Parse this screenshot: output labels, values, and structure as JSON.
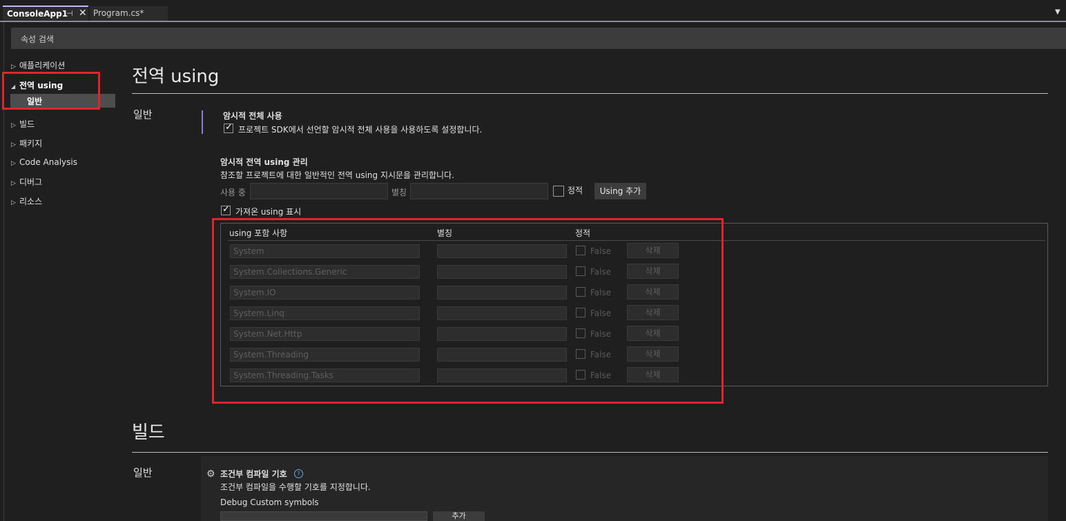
{
  "tabs": {
    "active": "ConsoleApp1",
    "inactive": "Program.cs*"
  },
  "search": {
    "placeholder": "속성 검색"
  },
  "nav": {
    "items": [
      {
        "label": "애플리케이션",
        "arrow": "▷"
      },
      {
        "label": "전역 using",
        "arrow": "◢"
      },
      {
        "label": "일반",
        "arrow": ""
      },
      {
        "label": "빌드",
        "arrow": "▷"
      },
      {
        "label": "패키지",
        "arrow": "▷"
      },
      {
        "label": "Code Analysis",
        "arrow": "▷"
      },
      {
        "label": "디버그",
        "arrow": "▷"
      },
      {
        "label": "리소스",
        "arrow": "▷"
      }
    ]
  },
  "main": {
    "heading": "전역 using",
    "section": "일반",
    "implicit": {
      "title": "암시적 전체 사용",
      "checkbox_label": "프로젝트 SDK에서 선언할 암시적 전체 사용을 사용하도록 설정합니다."
    },
    "manage": {
      "title": "암시적 전역 using 관리",
      "desc": "참조할 프로젝트에 대한 일반적인 전역 using 지시문을 관리합니다.",
      "using_label": "사용 중",
      "alias_label": "별칭",
      "static_label": "정적",
      "add_button": "Using 추가",
      "show_imported": "가져온 using 표시"
    },
    "table": {
      "columns": [
        "using 포함 사항",
        "별칭",
        "정적"
      ],
      "rows": [
        {
          "name": "System",
          "static": "False",
          "delete": "삭제"
        },
        {
          "name": "System.Collections.Generic",
          "static": "False",
          "delete": "삭제"
        },
        {
          "name": "System.IO",
          "static": "False",
          "delete": "삭제"
        },
        {
          "name": "System.Linq",
          "static": "False",
          "delete": "삭제"
        },
        {
          "name": "System.Net.Http",
          "static": "False",
          "delete": "삭제"
        },
        {
          "name": "System.Threading",
          "static": "False",
          "delete": "삭제"
        },
        {
          "name": "System.Threading.Tasks",
          "static": "False",
          "delete": "삭제"
        }
      ]
    },
    "build": {
      "heading": "빌드",
      "section": "일반",
      "cond_title": "조건부 컴파일 기호",
      "cond_desc": "조건부 컴파일을 수행할 기호를 지정합니다.",
      "debug_label": "Debug Custom symbols",
      "add_button": "추가"
    }
  }
}
